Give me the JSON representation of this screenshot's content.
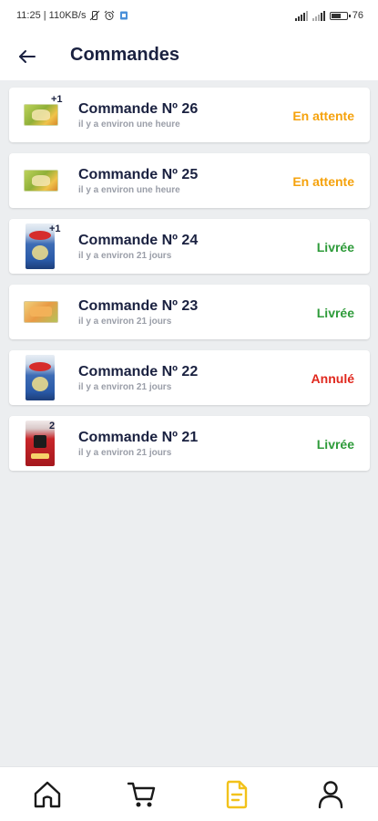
{
  "status_bar": {
    "time_speed": "11:25 | 110KB/s",
    "battery_text": "76",
    "battery_level_percent": 76
  },
  "header": {
    "title": "Commandes"
  },
  "orders": [
    {
      "name": "Commande Nº 26",
      "time": "il y a environ une heure",
      "status": "En attente",
      "status_color": "#f5a20c",
      "thumbnail": "green-food-package",
      "quantity_badge": "+1"
    },
    {
      "name": "Commande Nº 25",
      "time": "il y a environ une heure",
      "status": "En attente",
      "status_color": "#f5a20c",
      "thumbnail": "green-food-package",
      "quantity_badge": ""
    },
    {
      "name": "Commande Nº 24",
      "time": "il y a environ 21 jours",
      "status": "Livrée",
      "status_color": "#2e9b3a",
      "thumbnail": "blue-product-box",
      "quantity_badge": "+1"
    },
    {
      "name": "Commande Nº 23",
      "time": "il y a environ 21 jours",
      "status": "Livrée",
      "status_color": "#2e9b3a",
      "thumbnail": "orange-food-package",
      "quantity_badge": ""
    },
    {
      "name": "Commande Nº 22",
      "time": "il y a environ 21 jours",
      "status": "Annulé",
      "status_color": "#e0271d",
      "thumbnail": "blue-product-box",
      "quantity_badge": ""
    },
    {
      "name": "Commande Nº 21",
      "time": "il y a environ 21 jours",
      "status": "Livrée",
      "status_color": "#2e9b3a",
      "thumbnail": "red-product-box",
      "quantity_badge": "2"
    }
  ],
  "bottom_nav": {
    "items": [
      {
        "icon": "home-icon",
        "active": false
      },
      {
        "icon": "cart-icon",
        "active": false
      },
      {
        "icon": "document-icon",
        "active": true
      },
      {
        "icon": "user-icon",
        "active": false
      }
    ],
    "active_color": "#f2c21b",
    "inactive_color": "#1a1a1a"
  },
  "colors": {
    "title": "#1a2140",
    "background": "#eceef0",
    "card": "#ffffff"
  }
}
